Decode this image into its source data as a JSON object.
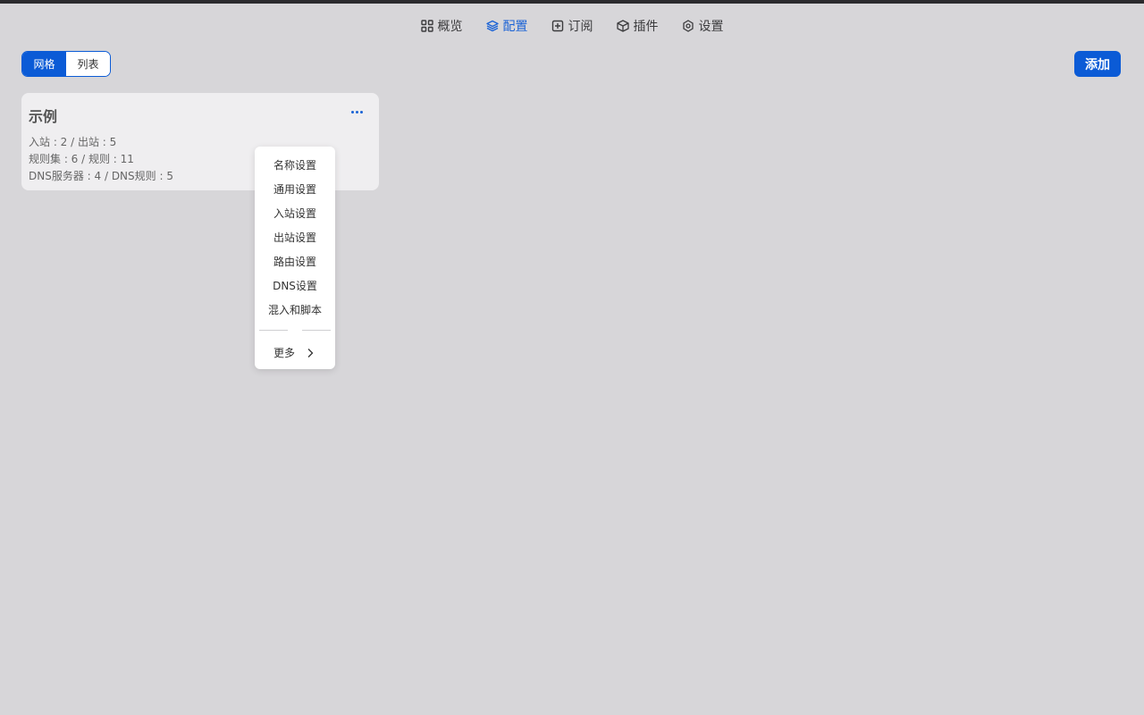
{
  "nav": {
    "items": [
      {
        "label": "概览",
        "icon": "grid-icon"
      },
      {
        "label": "配置",
        "icon": "layers-icon",
        "active": true
      },
      {
        "label": "订阅",
        "icon": "subscribe-icon"
      },
      {
        "label": "插件",
        "icon": "box-icon"
      },
      {
        "label": "设置",
        "icon": "settings-icon"
      }
    ]
  },
  "toolbar": {
    "view_grid": "网格",
    "view_list": "列表",
    "add_label": "添加"
  },
  "card": {
    "title": "示例",
    "line1": "入站 : 2 / 出站 : 5",
    "line2": "规则集 : 6 / 规则 : 11",
    "line3": "DNS服务器 : 4 / DNS规则 : 5"
  },
  "menu": {
    "items": [
      "名称设置",
      "通用设置",
      "入站设置",
      "出站设置",
      "路由设置",
      "DNS设置",
      "混入和脚本"
    ],
    "more_label": "更多"
  },
  "colors": {
    "accent": "#0b5bd6",
    "background": "#d7d6d9"
  }
}
